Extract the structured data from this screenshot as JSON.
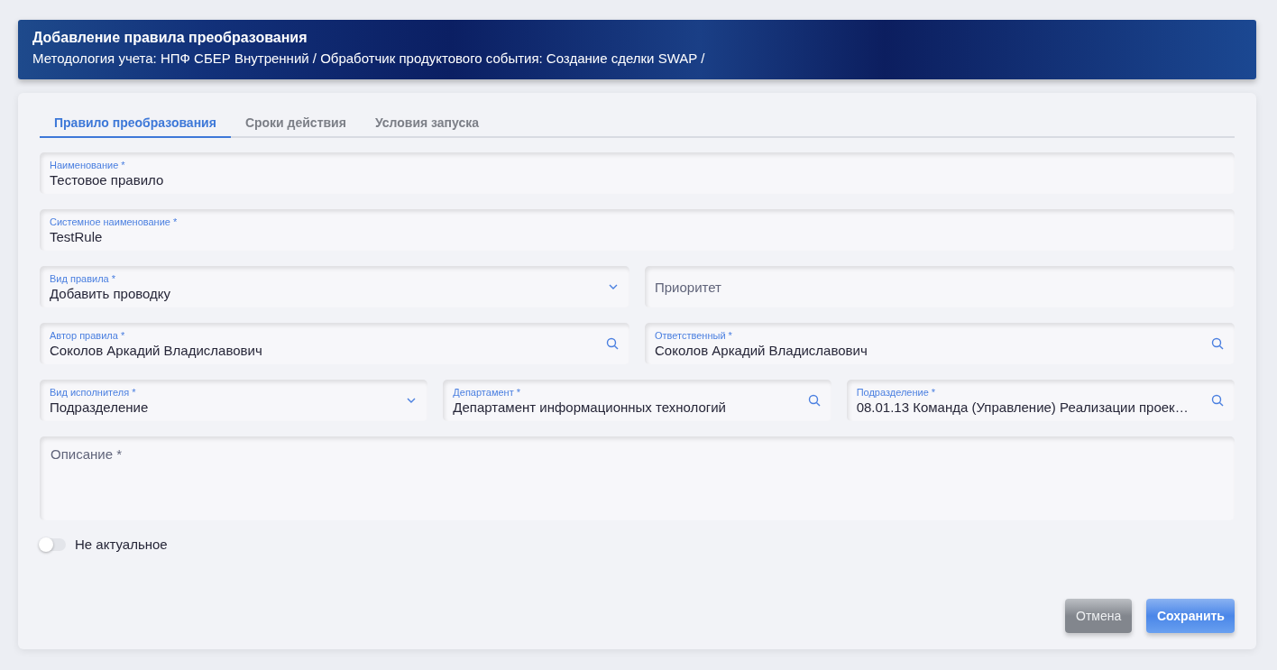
{
  "header": {
    "title": "Добавление правила преобразования",
    "breadcrumb": "Методология учета: НПФ СБЕР Внутренний / Обработчик продуктового события: Создание сделки SWAP /"
  },
  "tabs": [
    {
      "label": "Правило преобразования",
      "selected": true
    },
    {
      "label": "Сроки действия",
      "selected": false
    },
    {
      "label": "Условия запуска",
      "selected": false
    }
  ],
  "field_rows": [
    {
      "fields": [
        {
          "kind": "text",
          "label": "Наименование *",
          "value": "Тестовое правило"
        }
      ]
    },
    {
      "fields": [
        {
          "kind": "text",
          "label": "Системное наименование *",
          "value": "TestRule"
        }
      ]
    },
    {
      "fields": [
        {
          "kind": "select",
          "label": "Вид правила *",
          "value": "Добавить проводку"
        },
        {
          "kind": "text",
          "placeholder": "Приоритет"
        }
      ]
    },
    {
      "fields": [
        {
          "kind": "search",
          "label": "Автор правила *",
          "value": "Соколов Аркадий Владиславович"
        },
        {
          "kind": "search",
          "label": "Ответственный *",
          "value": "Соколов Аркадий Владиславович"
        }
      ]
    },
    {
      "fields": [
        {
          "kind": "select",
          "label": "Вид исполнителя *",
          "value": "Подразделение"
        },
        {
          "kind": "search",
          "label": "Департамент *",
          "value": "Департамент информационных технологий"
        },
        {
          "kind": "search",
          "label": "Подразделение *",
          "value": "08.01.13 Команда (Управление) Реализации проек…"
        }
      ]
    }
  ],
  "description": {
    "placeholder": "Описание *"
  },
  "toggle": {
    "label": "Не актуальное",
    "on": false
  },
  "buttons": [
    {
      "kind": "secondary",
      "label": "Отмена"
    },
    {
      "kind": "primary",
      "label": "Сохранить"
    }
  ]
}
